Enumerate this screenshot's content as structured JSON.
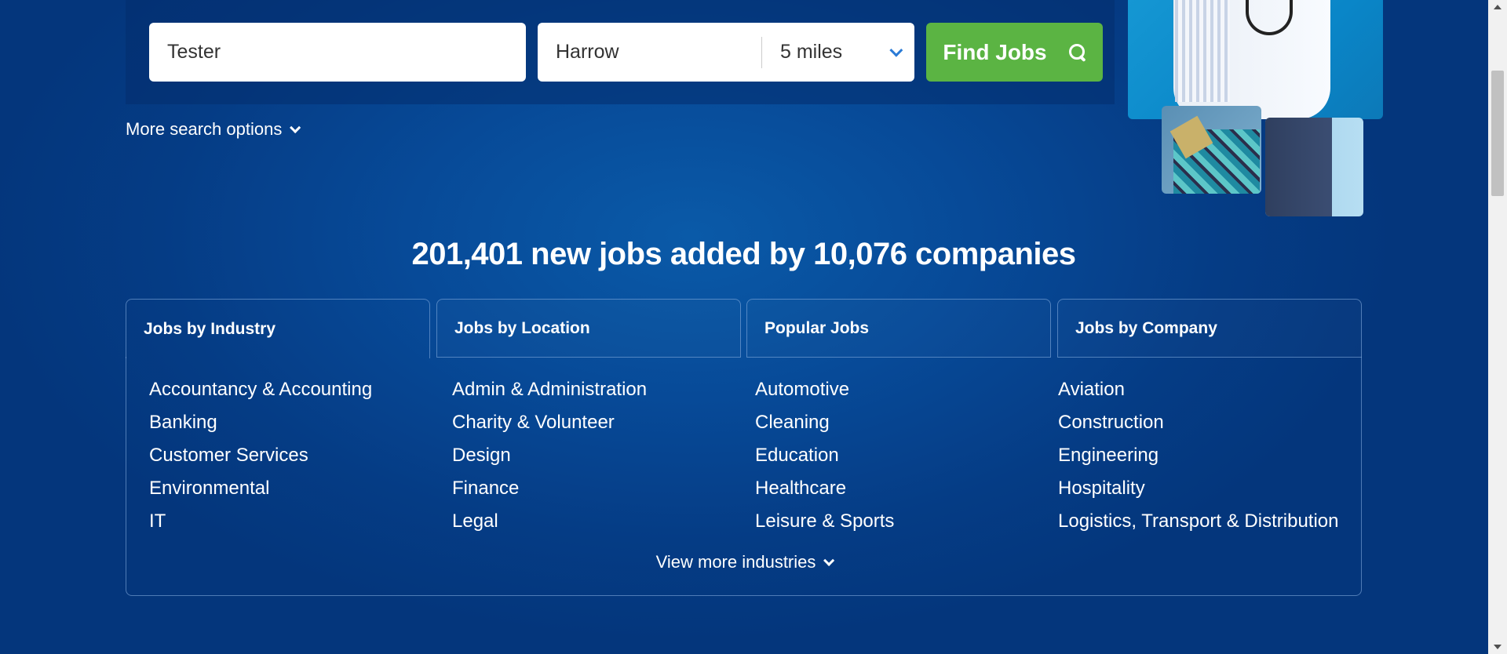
{
  "search": {
    "keyword_value": "Tester",
    "location_value": "Harrow",
    "radius_value": "5 miles",
    "find_label": "Find Jobs",
    "more_options_label": "More search options"
  },
  "headline": "201,401 new jobs added by 10,076 companies",
  "tabs": [
    {
      "label": "Jobs by Industry",
      "active": true
    },
    {
      "label": "Jobs by Location",
      "active": false
    },
    {
      "label": "Popular Jobs",
      "active": false
    },
    {
      "label": "Jobs by Company",
      "active": false
    }
  ],
  "industries": {
    "col1": [
      "Accountancy & Accounting",
      "Banking",
      "Customer Services",
      "Environmental",
      "IT"
    ],
    "col2": [
      "Admin & Administration",
      "Charity & Volunteer",
      "Design",
      "Finance",
      "Legal"
    ],
    "col3": [
      "Automotive",
      "Cleaning",
      "Education",
      "Healthcare",
      "Leisure & Sports"
    ],
    "col4": [
      "Aviation",
      "Construction",
      "Engineering",
      "Hospitality",
      "Logistics, Transport & Distribution"
    ]
  },
  "view_more_label": "View more industries",
  "colors": {
    "background": "#054080",
    "find_button": "#5bb443",
    "dropdown_chevron": "#2b7bd6"
  },
  "icons": [
    "search-icon",
    "chevron-down-icon"
  ]
}
